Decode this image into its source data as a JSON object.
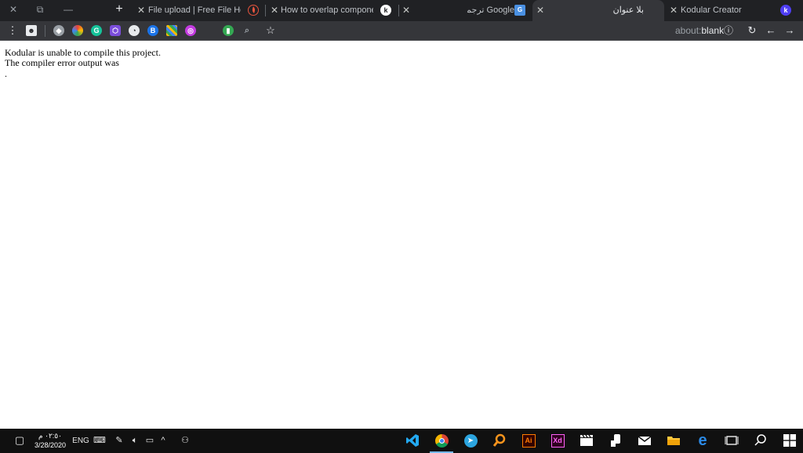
{
  "window_controls": {
    "close": "✕",
    "restore": "⧉",
    "minimize": "—"
  },
  "tabs": [
    {
      "title": "File upload | Free File Hosting",
      "favicon": "flame-icon",
      "active": false
    },
    {
      "title": "How to overlap components?",
      "favicon": "kodular-icon",
      "active": false
    },
    {
      "title": "Google ترجمة",
      "favicon": "google-translate-icon",
      "active": false
    },
    {
      "title": "بلا عنوان",
      "favicon": "none",
      "active": true
    },
    {
      "title": "Kodular Creator",
      "favicon": "kodular-icon",
      "active": false
    }
  ],
  "new_tab_label": "+",
  "close_glyph": "✕",
  "toolbar": {
    "url_scheme": "about:",
    "url_path": "blank",
    "extensions": [
      "grammarly-icon",
      "stylus-icon",
      "color-picker-icon",
      "vpn-icon",
      "qr-icon",
      "reader-icon"
    ]
  },
  "page": {
    "line1": "Kodular is unable to compile this project.",
    "line2": "The compiler error output was",
    "line3": "."
  },
  "taskbar": {
    "language": "ENG",
    "time": "٠٢:٥٠ م",
    "date": "3/28/2020",
    "apps": [
      "vscode-icon",
      "chrome-icon",
      "telegram-icon",
      "search-app-icon",
      "illustrator-icon",
      "xd-icon",
      "video-editor-icon",
      "speaker-app-icon",
      "mail-icon",
      "file-explorer-icon",
      "edge-icon",
      "task-view-icon",
      "search-icon",
      "start-icon"
    ],
    "illustrator_label": "Ai",
    "xd_label": "Xd"
  },
  "colors": {
    "tab_strip": "#202124",
    "toolbar": "#35363a",
    "taskbar": "#101010",
    "accent_blue": "#76b9ed"
  }
}
